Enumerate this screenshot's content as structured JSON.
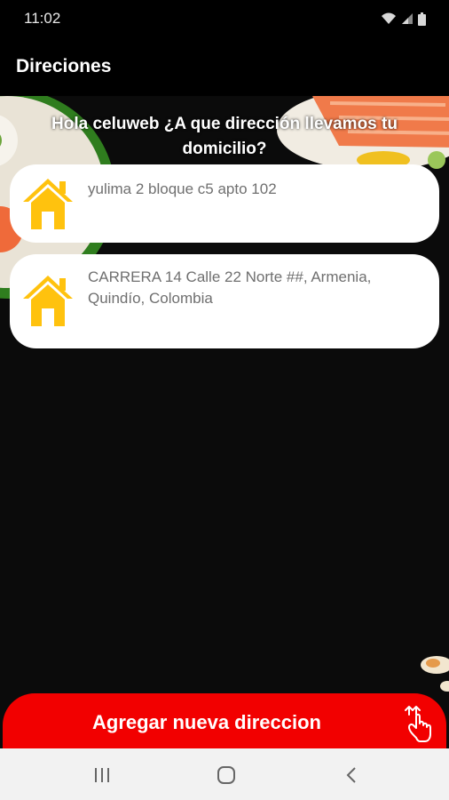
{
  "status_bar": {
    "time": "11:02"
  },
  "app_bar": {
    "title": "Direciones"
  },
  "greeting": "Hola celuweb ¿A que dirección llevamos tu domicilio?",
  "addresses": [
    {
      "text": "yulima 2 bloque c5 apto 102"
    },
    {
      "text": "CARRERA 14 Calle 22 Norte ##, Armenia, Quindío, Colombia"
    }
  ],
  "add_button": {
    "label": "Agregar nueva direccion"
  },
  "colors": {
    "accent": "#F20000",
    "house": "#FFC20E",
    "card_bg": "#FFFFFF",
    "background": "#0B0B0B"
  }
}
